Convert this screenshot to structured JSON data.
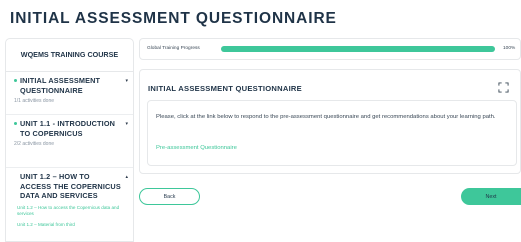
{
  "page": {
    "title": "INITIAL ASSESSMENT QUESTIONNAIRE"
  },
  "sidebar": {
    "course_title": "WQEMS TRAINING COURSE",
    "units": [
      {
        "title": "INITIAL ASSESSMENT QUESTIONNAIRE",
        "meta": "1/1 activities done",
        "caret": "▾",
        "completed": true
      },
      {
        "title": "UNIT 1.1 - INTRODUCTION TO COPERNICUS",
        "meta": "2/2 activities done",
        "caret": "▾",
        "completed": true
      },
      {
        "title": "UNIT 1.2 – HOW TO ACCESS THE COPERNICUS DATA AND SERVICES",
        "caret": "▴",
        "completed": false,
        "activities": [
          "Unit 1.2 – How to access the Copernicus data and services",
          "Unit 1.2 – Material from third"
        ]
      }
    ]
  },
  "progress": {
    "label": "Global Training Progress",
    "value_text": "100%",
    "value": 1.0
  },
  "main": {
    "title": "INITIAL ASSESSMENT QUESTIONNAIRE",
    "instruction": "Please, click at the link below to respond to the pre-assessment questionnaire and get recommendations about your learning path.",
    "link_text": "Pre-assessment Questionnaire"
  },
  "nav": {
    "back_label": "Back",
    "next_label": "Next"
  },
  "icons": {
    "expand": "expand-icon",
    "caret": "caret-icon"
  },
  "colors": {
    "accent": "#3ec79a",
    "heading": "#1f3347",
    "text": "#3a4856",
    "muted": "#8a96a3",
    "border": "#e6e8ea"
  }
}
